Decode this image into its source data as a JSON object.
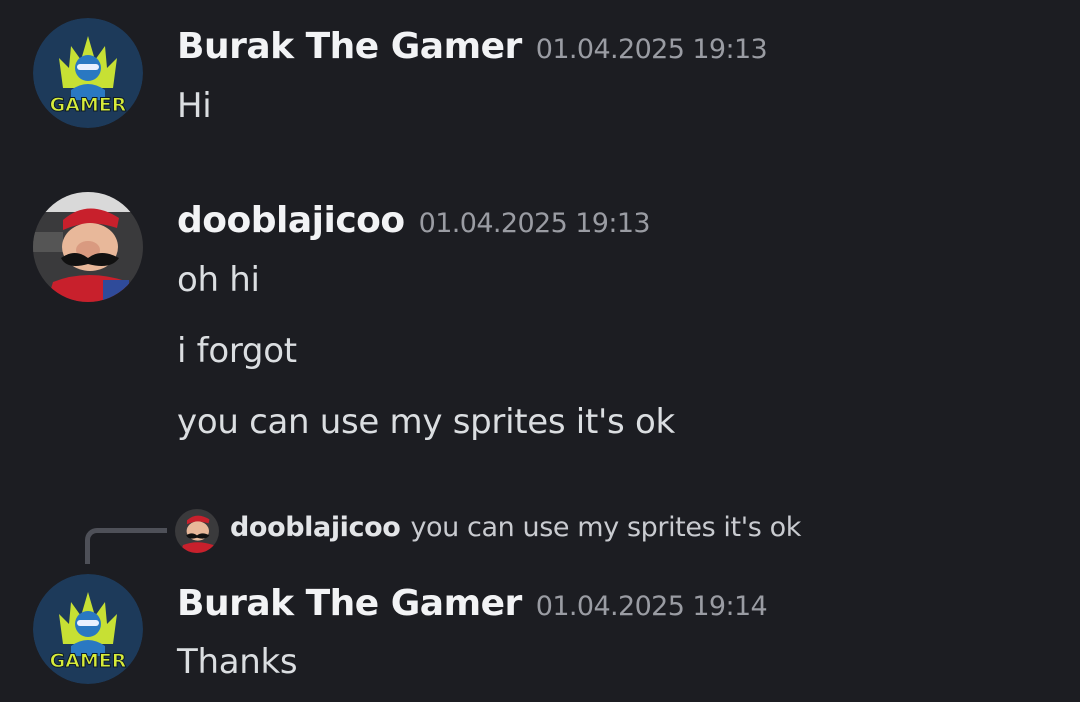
{
  "messages": [
    {
      "username": "Burak The Gamer",
      "timestamp": "01.04.2025 19:13",
      "avatar_text": "GAMER",
      "lines": [
        "Hi"
      ]
    },
    {
      "username": "dooblajicoo",
      "timestamp": "01.04.2025 19:13",
      "lines": [
        "oh hi",
        "i forgot",
        "you can use my sprites it's ok"
      ]
    },
    {
      "reply": {
        "username": "dooblajicoo",
        "content": "you can use my sprites it's ok"
      },
      "username": "Burak The Gamer",
      "timestamp": "01.04.2025 19:14",
      "avatar_text": "GAMER",
      "lines": [
        "Thanks"
      ]
    }
  ],
  "colors": {
    "background": "#1c1d22",
    "username": "#f2f3f5",
    "timestamp": "#9a9ca3",
    "message": "#dbdee1",
    "reply_line": "#4e5058"
  }
}
